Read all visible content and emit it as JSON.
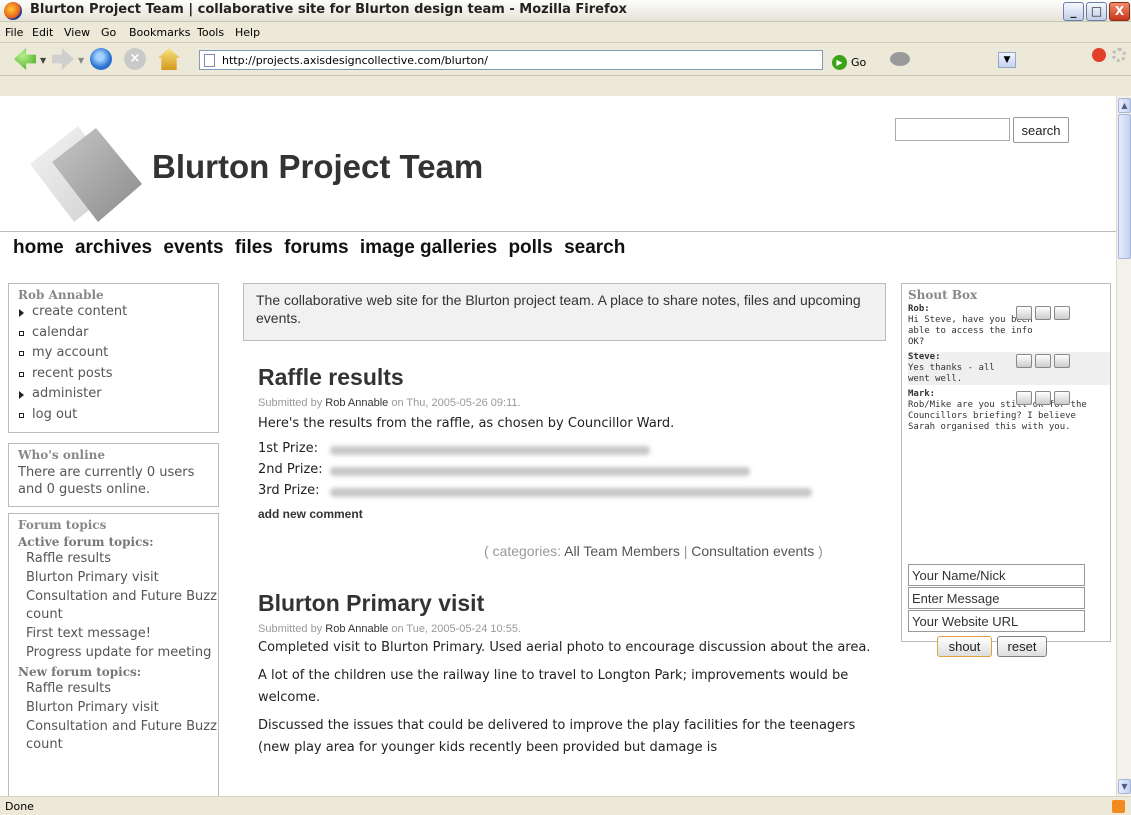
{
  "window": {
    "title": "Blurton Project Team | collaborative site for Blurton design team - Mozilla Firefox",
    "minimize": "_",
    "maximize": "□",
    "close": "X"
  },
  "menu": [
    "File",
    "Edit",
    "View",
    "Go",
    "Bookmarks",
    "Tools",
    "Help"
  ],
  "toolbar": {
    "url": "http://projects.axisdesigncollective.com/blurton/",
    "go_label": "Go",
    "back_icon": "back-arrow-icon",
    "forward_icon": "forward-arrow-icon",
    "reload_icon": "reload-icon",
    "stop_icon": "stop-icon",
    "home_icon": "home-icon"
  },
  "status": {
    "text": "Done"
  },
  "site": {
    "title": "Blurton Project Team",
    "search_button": "search",
    "nav": [
      "home",
      "archives",
      "events",
      "files",
      "forums",
      "image galleries",
      "polls",
      "search"
    ]
  },
  "user_block": {
    "title": "Rob Annable",
    "items": [
      {
        "label": "create content",
        "bullet": "triangle"
      },
      {
        "label": "calendar",
        "bullet": "square"
      },
      {
        "label": "my account",
        "bullet": "square"
      },
      {
        "label": "recent posts",
        "bullet": "square"
      },
      {
        "label": "administer",
        "bullet": "triangle"
      },
      {
        "label": "log out",
        "bullet": "square"
      }
    ]
  },
  "online_block": {
    "title": "Who's online",
    "text": "There are currently 0 users and 0 guests online."
  },
  "forum_block": {
    "title": "Forum topics",
    "active_label": "Active forum topics:",
    "active": [
      "Raffle results",
      "Blurton Primary visit",
      "Consultation and Future Buzz count",
      "First text message!",
      "Progress update for meeting"
    ],
    "new_label": "New forum topics:",
    "new": [
      "Raffle results",
      "Blurton Primary visit",
      "Consultation and Future Buzz count"
    ]
  },
  "mission": "The collaborative web site for the Blurton project team. A place to share notes, files and upcoming events.",
  "node_raffle": {
    "title": "Raffle results",
    "submitted_prefix": "Submitted by",
    "author": "Rob Annable",
    "date": "on Thu, 2005-05-26 09:11.",
    "intro": "Here's the results from the raffle, as chosen by Councillor Ward.",
    "prizes": [
      "1st Prize:",
      "2nd Prize:",
      "3rd Prize:"
    ],
    "add_comment": "add new comment",
    "categories_prefix": "( categories:",
    "categories": [
      "All Team Members",
      "Consultation events"
    ],
    "categories_sep": "|",
    "categories_suffix": ")"
  },
  "node_primary": {
    "title": "Blurton Primary visit",
    "submitted_prefix": "Submitted by",
    "author": "Rob Annable",
    "date": "on Tue, 2005-05-24 10:55.",
    "paragraphs": [
      "Completed visit to Blurton Primary. Used aerial photo to encourage discussion about the area.",
      "A lot of the children use the railway line to travel to Longton Park; improvements would be welcome.",
      "Discussed the issues that could be delivered to improve the play facilities for the teenagers (new play area for younger kids recently been provided but damage is"
    ]
  },
  "shoutbox": {
    "title": "Shout Box",
    "messages": [
      {
        "name": "Rob:",
        "text": "Hi Steve, have you been able to access the info OK?"
      },
      {
        "name": "Steve:",
        "text": "Yes thanks - all went well."
      },
      {
        "name": "Mark:",
        "text": "Rob/Mike are you still ok for the Councillors briefing? I believe Sarah organised this with you."
      }
    ],
    "name_value": "Your Name/Nick",
    "message_value": "Enter Message",
    "url_value": "Your Website URL",
    "shout_button": "shout",
    "reset_button": "reset"
  }
}
